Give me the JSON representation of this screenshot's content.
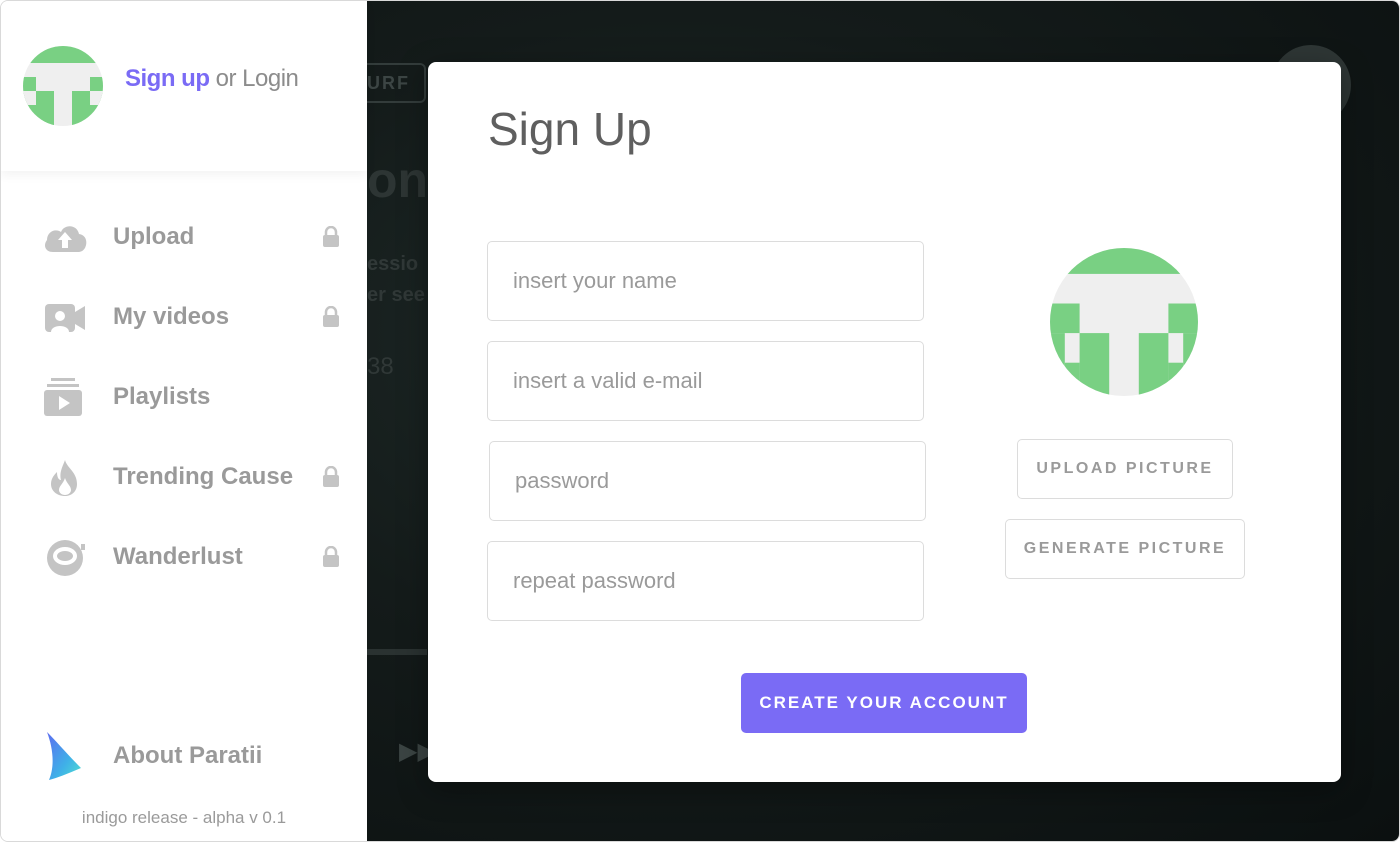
{
  "sidebar": {
    "auth": {
      "signup_label": "Sign up",
      "login_label": " or Login"
    },
    "items": [
      {
        "label": "Upload",
        "icon": "cloud-upload-icon",
        "locked": true
      },
      {
        "label": "My videos",
        "icon": "video-camera-icon",
        "locked": true
      },
      {
        "label": "Playlists",
        "icon": "playlist-icon",
        "locked": false
      },
      {
        "label": "Trending Cause",
        "icon": "fire-icon",
        "locked": true
      },
      {
        "label": "Wanderlust",
        "icon": "astronaut-helmet-icon",
        "locked": true
      }
    ],
    "about_label": "About Paratii",
    "version": "indigo release - alpha v 0.1"
  },
  "background": {
    "tag": "URF",
    "title_fragment": "one",
    "line1": "essio",
    "line2": "er see",
    "number": "38",
    "forward_icon": "fast-forward-icon"
  },
  "modal": {
    "title": "Sign Up",
    "fields": {
      "name_placeholder": "insert your name",
      "email_placeholder": "insert a valid e-mail",
      "password_placeholder": "password",
      "repeat_password_placeholder": "repeat password"
    },
    "upload_picture_label": "UPLOAD PICTURE",
    "generate_picture_label": "GENERATE PICTURE",
    "create_account_label": "CREATE YOUR ACCOUNT"
  },
  "colors": {
    "accent": "#7a6bf5",
    "avatar_green": "#79d083",
    "avatar_light": "#efefef",
    "muted_text": "#9a9a9a"
  }
}
